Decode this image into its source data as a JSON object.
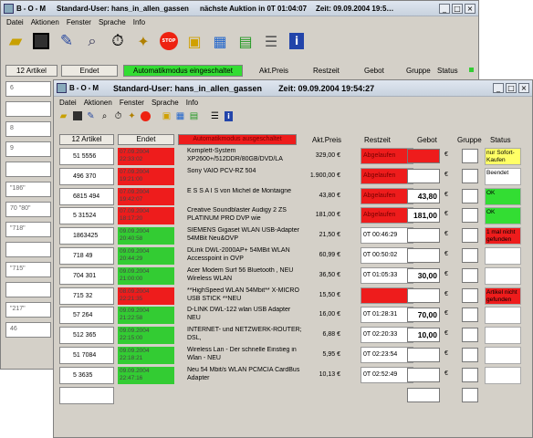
{
  "back": {
    "title_app": "B-O-M",
    "title_user": "Standard-User: hans_in_allen_gassen",
    "title_next": "nächste Auktion in 0T 01:04:07",
    "title_time": "Zeit: 09.09.2004 19:5…",
    "menu": [
      "Datei",
      "Aktionen",
      "Fenster",
      "Sprache",
      "Info"
    ],
    "btn_articles": "12 Artikel",
    "btn_end": "Endet",
    "btn_auto": "Automatikmodus eingeschaltet",
    "col_price": "Akt.Preis",
    "col_rest": "Restzeit",
    "col_bid": "Gebot",
    "col_group": "Gruppe",
    "col_status": "Status",
    "items": [
      "6",
      "",
      "8",
      "9",
      "",
      "\"186\"",
      "70 \"80\"",
      "\"718\"",
      "",
      "\"715\"",
      "",
      "\"217\"",
      "46"
    ]
  },
  "front": {
    "title_app": "B-O-M",
    "title_user": "Standard-User: hans_in_allen_gassen",
    "title_time": "Zeit: 09.09.2004 19:54:27",
    "menu": [
      "Datei",
      "Aktionen",
      "Fenster",
      "Sprache",
      "Info"
    ],
    "btn_articles": "12 Artikel",
    "btn_end": "Endet",
    "btn_auto": "Automatikmodus ausgeschaltet",
    "col_price": "Akt.Preis",
    "col_rest": "Restzeit",
    "col_bid": "Gebot",
    "col_group": "Gruppe",
    "col_status": "Status",
    "currency": "€",
    "rows": [
      {
        "id": "51  5556",
        "end": "07.09.2004 22:33:02",
        "end_color": "#ee1c1c",
        "desc": "Komplett-System XP2600+/512DDR/80GB/DVD/LA",
        "price": "329,00 €",
        "rest": "Abgelaufen",
        "rest_color": "#ee1c1c",
        "bid": "",
        "bid_color": "#ee1c1c",
        "status": "nur Sofort-Kaufen",
        "status_color": "#ffff66"
      },
      {
        "id": "496  370",
        "end": "07.09.2004 19:21:00",
        "end_color": "#ee1c1c",
        "desc": "Sony VAIO PCV-RZ 504",
        "price": "1.900,00 €",
        "rest": "Abgelaufen",
        "rest_color": "#ee1c1c",
        "bid": "",
        "bid_color": "#ffffff",
        "status": "Beendet",
        "status_color": "#ffffff"
      },
      {
        "id": "6815    494",
        "end": "07.09.2004 19:42:07",
        "end_color": "#ee1c1c",
        "desc": "E S S A I S   von Michel de Montaigne",
        "price": "43,80 €",
        "rest": "Abgelaufen",
        "rest_color": "#ee1c1c",
        "bid": "43,80",
        "bid_color": "#ffffff",
        "status": "OK",
        "status_color": "#33dd33"
      },
      {
        "id": "5   31524",
        "end": "07.09.2004 18:17:20",
        "end_color": "#ee1c1c",
        "desc": "Creative Soundblaster Audigy 2 ZS PLATINUM PRO DVP wie",
        "price": "181,00 €",
        "rest": "Abgelaufen",
        "rest_color": "#ee1c1c",
        "bid": "181,00",
        "bid_color": "#ffffff",
        "status": "OK",
        "status_color": "#33dd33"
      },
      {
        "id": "1863425",
        "end": "09.09.2004 20:40:58",
        "end_color": "#33cc33",
        "desc": "SIEMENS Gigaset WLAN USB-Adapter 54MBit Neu&OVP",
        "price": "21,50 €",
        "rest": "0T 00:46:29",
        "rest_color": "#ffffff",
        "bid": "",
        "bid_color": "#ffffff",
        "status": "1 mal nicht gefunden",
        "status_color": "#ee1c1c"
      },
      {
        "id": "718   49",
        "end": "09.09.2004 20:44:29",
        "end_color": "#33cc33",
        "desc": "DLink DWL-2000AP+ 54MBit WLAN Accesspoint in OVP",
        "price": "60,99 €",
        "rest": "0T 00:50:02",
        "rest_color": "#ffffff",
        "bid": "",
        "bid_color": "#ffffff",
        "status": "",
        "status_color": "#ffffff"
      },
      {
        "id": "704   301",
        "end": "09.09.2004 21:00:00",
        "end_color": "#33cc33",
        "desc": "Acer Modem Surf 56 Bluetooth , NEU Wireless WLAN",
        "price": "36,50 €",
        "rest": "0T 01:05:33",
        "rest_color": "#ffffff",
        "bid": "30,00",
        "bid_color": "#ffffff",
        "status": "",
        "status_color": "#ffffff"
      },
      {
        "id": "715   32",
        "end": "08.09.2004 22:21:35",
        "end_color": "#ee1c1c",
        "desc": "**HighSpeed WLAN 54Mbit** X-MICRO USB STICK **NEU",
        "price": "15,50 €",
        "rest": "",
        "rest_color": "#ee1c1c",
        "bid": "",
        "bid_color": "#ffffff",
        "status": "Artikel nicht gefunden",
        "status_color": "#ee1c1c"
      },
      {
        "id": "57   264",
        "end": "09.09.2004 21:22:58",
        "end_color": "#33cc33",
        "desc": "D-LINK DWL-122 wlan USB Adapter NEU",
        "price": "16,00 €",
        "rest": "0T 01:28:31",
        "rest_color": "#ffffff",
        "bid": "70,00",
        "bid_color": "#ffffff",
        "status": "",
        "status_color": "#ffffff"
      },
      {
        "id": "512   365",
        "end": "09.09.2004 22:15:00",
        "end_color": "#33cc33",
        "desc": "INTERNET- und NETZWERK-ROUTER; DSL,",
        "price": "6,88 €",
        "rest": "0T 02:20:33",
        "rest_color": "#ffffff",
        "bid": "10,00",
        "bid_color": "#ffffff",
        "status": "",
        "status_color": "#ffffff"
      },
      {
        "id": "51   7084",
        "end": "09.09.2004 22:18:21",
        "end_color": "#33cc33",
        "desc": "Wireless Lan - Der schnelle Einstieg in Wlan - NEU",
        "price": "5,95 €",
        "rest": "0T 02:23:54",
        "rest_color": "#ffffff",
        "bid": "",
        "bid_color": "#ffffff",
        "status": "",
        "status_color": "#ffffff"
      },
      {
        "id": "5   3635",
        "end": "09.09.2004 22:47:16",
        "end_color": "#33cc33",
        "desc": "Neu 54 Mbit/s WLAN PCMCIA CardBus Adapter",
        "price": "10,13 €",
        "rest": "0T 02:52:49",
        "rest_color": "#ffffff",
        "bid": "",
        "bid_color": "#ffffff",
        "status": "",
        "status_color": "#ffffff"
      }
    ]
  }
}
